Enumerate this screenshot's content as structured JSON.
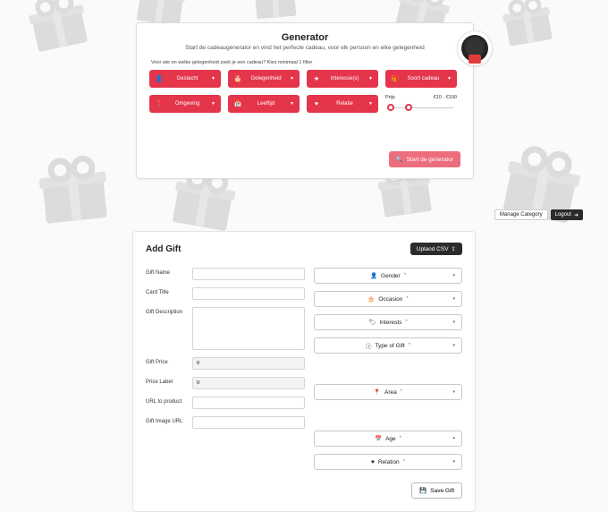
{
  "generator": {
    "title": "Generator",
    "subtitle": "Start de cadeaugenerator en vind het perfecte cadeau, voor elk persoon en elke gelegenheid",
    "hint": "Voor wie en welke gelegenheid zoek je een cadeau? Kies minimaal 1 filter",
    "filters": [
      {
        "key": "gender",
        "icon": "person-icon",
        "label": "Geslacht"
      },
      {
        "key": "occasion",
        "icon": "cake-icon",
        "label": "Gelegenheid"
      },
      {
        "key": "interest",
        "icon": "star-icon",
        "label": "Interesse(s)"
      },
      {
        "key": "gifttype",
        "icon": "gift-icon",
        "label": "Soort cadeau"
      },
      {
        "key": "area",
        "icon": "pin-icon",
        "label": "Omgeving"
      },
      {
        "key": "age",
        "icon": "calendar-icon",
        "label": "Leeftijd"
      },
      {
        "key": "relation",
        "icon": "heart-icon",
        "label": "Relatie"
      }
    ],
    "price": {
      "label": "Prijs",
      "range_text": "€10 - €100"
    },
    "start_btn": "Start de generator"
  },
  "actionbar": {
    "manage": "Manage Category",
    "logout": "Logout"
  },
  "form": {
    "title": "Add Gift",
    "upload": "Uplaod CSV",
    "left": {
      "name": {
        "label": "Gift Name",
        "value": ""
      },
      "card_title": {
        "label": "Card Title",
        "value": ""
      },
      "desc": {
        "label": "Gift Description",
        "value": ""
      },
      "price": {
        "label": "Gift Price",
        "value": "0"
      },
      "pricelabel": {
        "label": "Price Label",
        "value": "0"
      },
      "url": {
        "label": "URL to product",
        "value": ""
      },
      "img": {
        "label": "Gift Image URL",
        "value": ""
      }
    },
    "right": [
      {
        "key": "gender",
        "icon": "person-icon",
        "label": "Gender",
        "required": true
      },
      {
        "key": "occasion",
        "icon": "cake-icon",
        "label": "Occasion",
        "required": true
      },
      {
        "key": "interest",
        "icon": "tag-icon",
        "label": "Interests",
        "required": true
      },
      {
        "key": "gifttype",
        "icon": "info-icon",
        "label": "Type of Gift",
        "required": true
      },
      {
        "key": "area",
        "icon": "pin-icon",
        "label": "Area",
        "required": true
      },
      {
        "key": "age",
        "icon": "calendar-icon",
        "label": "Age",
        "required": true
      },
      {
        "key": "relation",
        "icon": "heart-icon",
        "label": "Relation",
        "required": true
      }
    ],
    "save": "Save Gift"
  }
}
